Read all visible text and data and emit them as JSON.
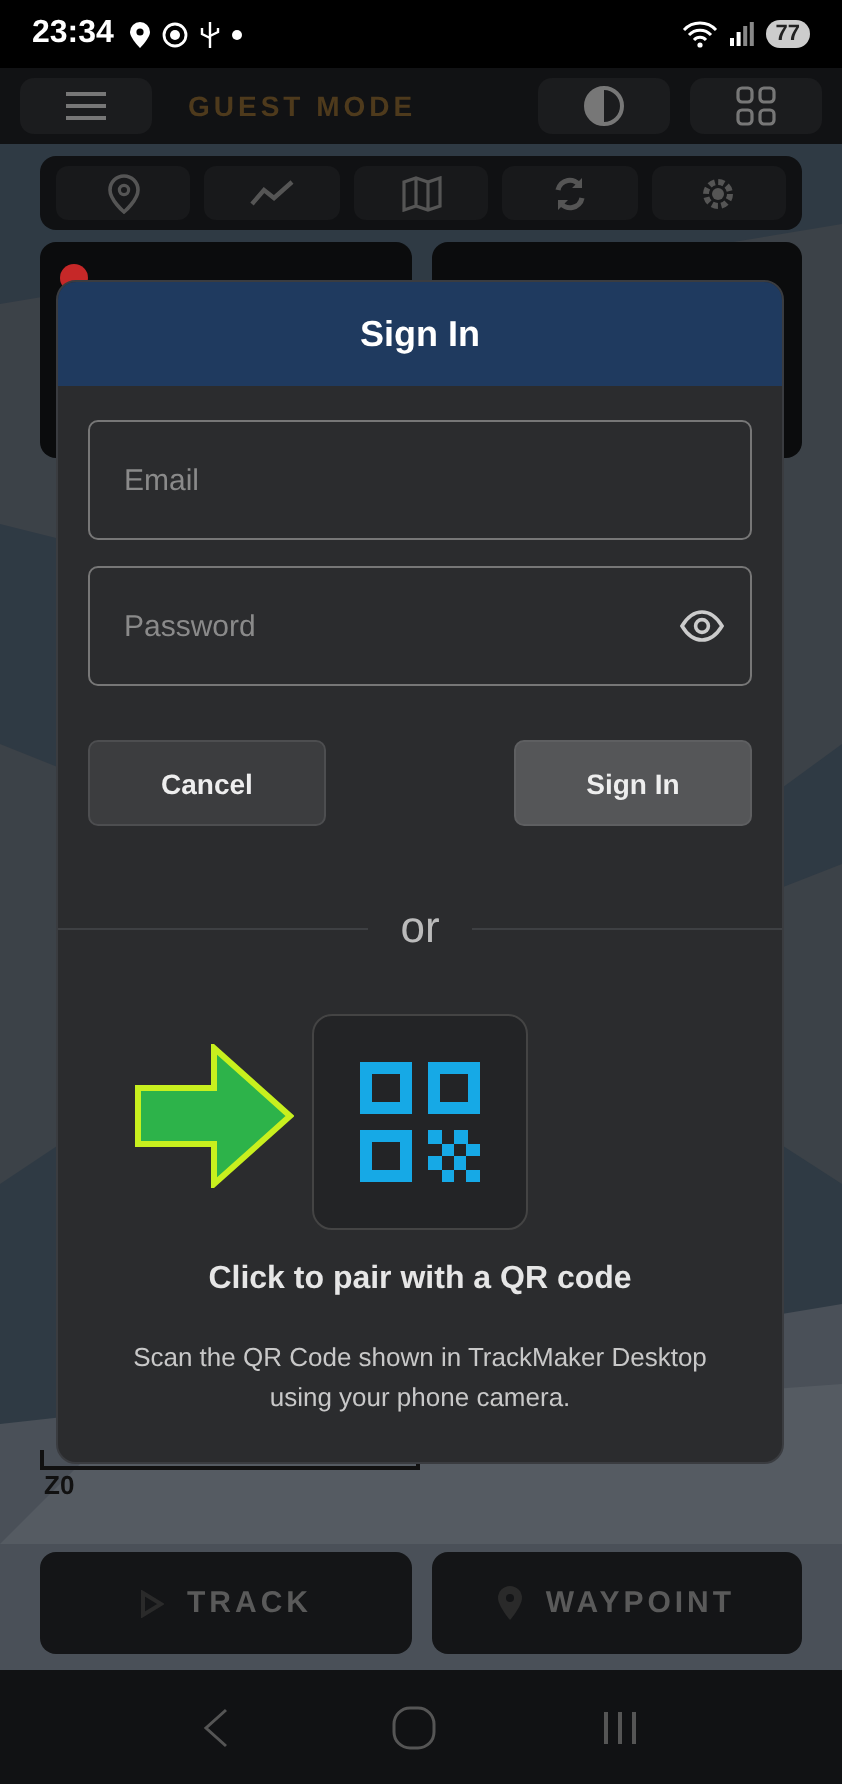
{
  "status_bar": {
    "time": "23:34",
    "battery": "77"
  },
  "header": {
    "mode_label": "GUEST MODE"
  },
  "toolbar": {
    "items": [
      {
        "kind": "pin"
      },
      {
        "kind": "chart"
      },
      {
        "kind": "map"
      },
      {
        "kind": "sync"
      },
      {
        "kind": "settings"
      }
    ]
  },
  "info_cards": [
    {
      "color": "#c62828"
    }
  ],
  "map": {
    "kind": "picture",
    "scale_label": "Z0"
  },
  "actions": [
    {
      "kind": "track",
      "label": "TRACK"
    },
    {
      "kind": "waypoint",
      "label": "WAYPOINT"
    }
  ],
  "dialog": {
    "title": "Sign In",
    "fields": [
      {
        "kind": "email",
        "placeholder": "Email"
      },
      {
        "kind": "password",
        "placeholder": "Password"
      }
    ],
    "buttons": [
      {
        "label": "Cancel",
        "kind": "secondary"
      },
      {
        "label": "Sign In",
        "kind": "primary"
      }
    ],
    "divider_text": "or",
    "qr_title": "Click to pair with a QR code",
    "qr_description": "Scan the QR Code shown in TrackMaker Desktop using your phone camera."
  }
}
